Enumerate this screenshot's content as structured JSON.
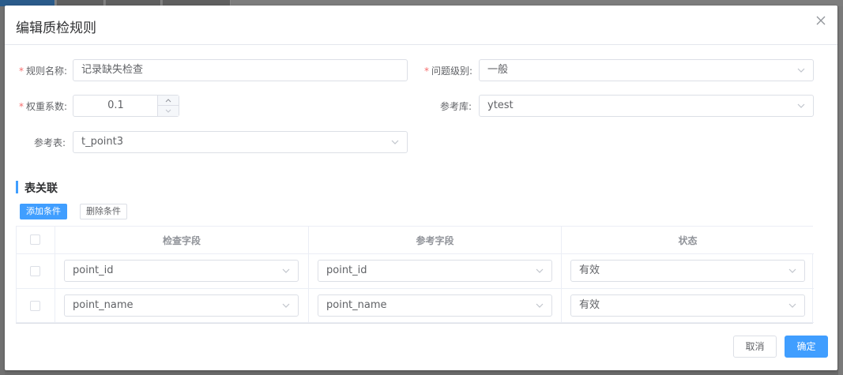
{
  "dialog": {
    "title": "编辑质检规则"
  },
  "form": {
    "rule_name": {
      "label": "规则名称:",
      "value": "记录缺失检查",
      "required": true
    },
    "issue_level": {
      "label": "问题级别:",
      "value": "一般",
      "required": true
    },
    "weight": {
      "label": "权重系数:",
      "value": "0.1",
      "required": true
    },
    "ref_db": {
      "label": "参考库:",
      "value": "ytest",
      "required": false
    },
    "ref_table": {
      "label": "参考表:",
      "value": "t_point3",
      "required": false
    }
  },
  "section": {
    "title": "表关联",
    "add_label": "添加条件",
    "delete_label": "删除条件"
  },
  "table": {
    "headers": [
      "检查字段",
      "参考字段",
      "状态"
    ],
    "rows": [
      {
        "check_field": "point_id",
        "ref_field": "point_id",
        "status": "有效"
      },
      {
        "check_field": "point_name",
        "ref_field": "point_name",
        "status": "有效"
      }
    ]
  },
  "footer": {
    "cancel_label": "取消",
    "confirm_label": "确定"
  },
  "colors": {
    "primary": "#409eff",
    "required": "#f56c6c",
    "border": "#dcdfe6"
  }
}
